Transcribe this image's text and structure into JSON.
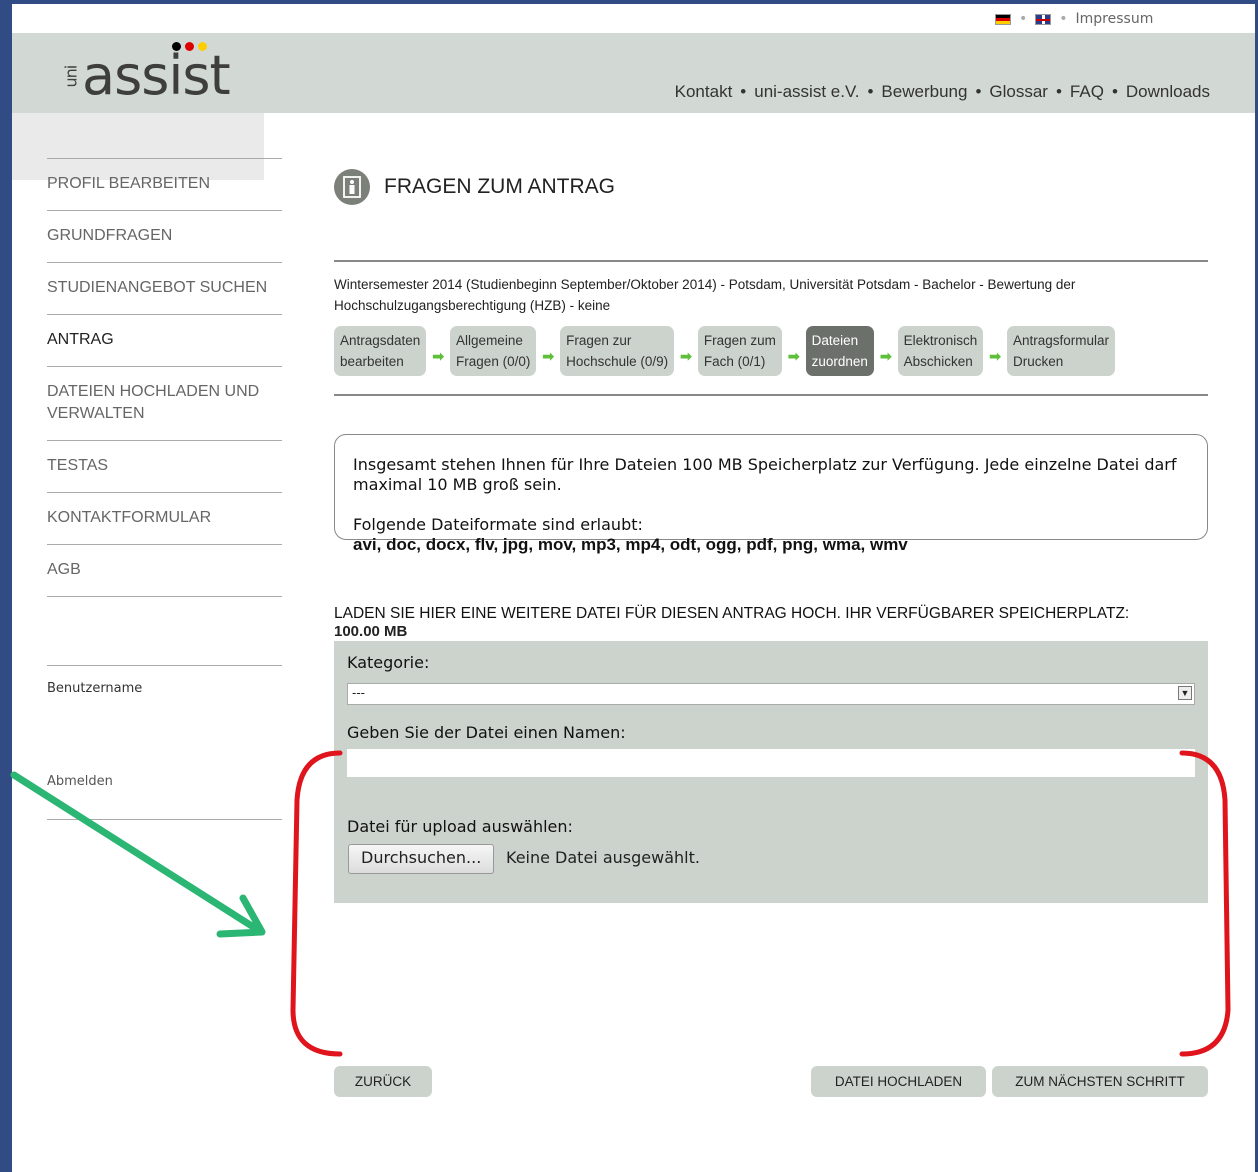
{
  "topbar": {
    "impressum": "Impressum",
    "separator": "•"
  },
  "logo": {
    "prefix": "uni",
    "word": "assist",
    "dot_colors": [
      "#000000",
      "#dd0000",
      "#ffce00"
    ]
  },
  "nav": [
    "Kontakt",
    "uni-assist e.V.",
    "Bewerbung",
    "Glossar",
    "FAQ",
    "Downloads"
  ],
  "sidebar": {
    "items": [
      {
        "label": "PROFIL BEARBEITEN"
      },
      {
        "label": "GRUNDFRAGEN"
      },
      {
        "label": "STUDIENANGEBOT SUCHEN"
      },
      {
        "label": "ANTRAG"
      },
      {
        "label": "DATEIEN HOCHLADEN UND VERWALTEN"
      },
      {
        "label": "TESTAS"
      },
      {
        "label": "KONTAKTFORMULAR"
      },
      {
        "label": "AGB"
      }
    ],
    "username_label": "Benutzername",
    "logout": "Abmelden"
  },
  "main": {
    "title": "FRAGEN ZUM ANTRAG",
    "program": "Wintersemester 2014 (Studienbeginn September/Oktober 2014) - Potsdam, Universität Potsdam - Bachelor - Bewertung der Hochschulzugangsberechtigung (HZB) - keine",
    "steps": [
      {
        "line1": "Antragsdaten",
        "line2": "bearbeiten"
      },
      {
        "line1": "Allgemeine",
        "line2": "Fragen (0/0)"
      },
      {
        "line1": "Fragen zur",
        "line2": "Hochschule (0/9)"
      },
      {
        "line1": "Fragen zum",
        "line2": "Fach (0/1)"
      },
      {
        "line1": "Dateien",
        "line2": "zuordnen"
      },
      {
        "line1": "Elektronisch",
        "line2": "Abschicken"
      },
      {
        "line1": "Antragsformular",
        "line2": "Drucken"
      }
    ],
    "info": {
      "text": "Insgesamt stehen Ihnen für Ihre Dateien 100 MB Speicherplatz zur Verfügung. Jede einzelne Datei darf maximal 10 MB groß sein.",
      "formats_label": "Folgende Dateiformate sind erlaubt:",
      "formats": "avi, doc, docx, flv, jpg, mov, mp3, mp4, odt, ogg, pdf, png, wma, wmv"
    },
    "upload": {
      "heading": "LADEN SIE HIER EINE WEITERE DATEI FÜR DIESEN ANTRAG HOCH. IHR VERFÜGBARER SPEICHERPLATZ:",
      "space": "100.00 MB",
      "category_label": "Kategorie:",
      "category_value": "---",
      "name_label": "Geben Sie der Datei einen Namen:",
      "name_value": "",
      "file_label": "Datei für upload auswählen:",
      "browse": "Durchsuchen...",
      "no_file": "Keine Datei ausgewählt."
    },
    "buttons": {
      "back": "ZURÜCK",
      "upload": "DATEI HOCHLADEN",
      "next": "ZUM NÄCHSTEN SCHRITT"
    }
  },
  "colors": {
    "frame": "#314c85",
    "header": "#d2d9d4",
    "panel": "#ccd3cd",
    "annotation_red": "#e0141c",
    "annotation_green": "#2bb673",
    "step_arrow": "#5fbf3a"
  }
}
